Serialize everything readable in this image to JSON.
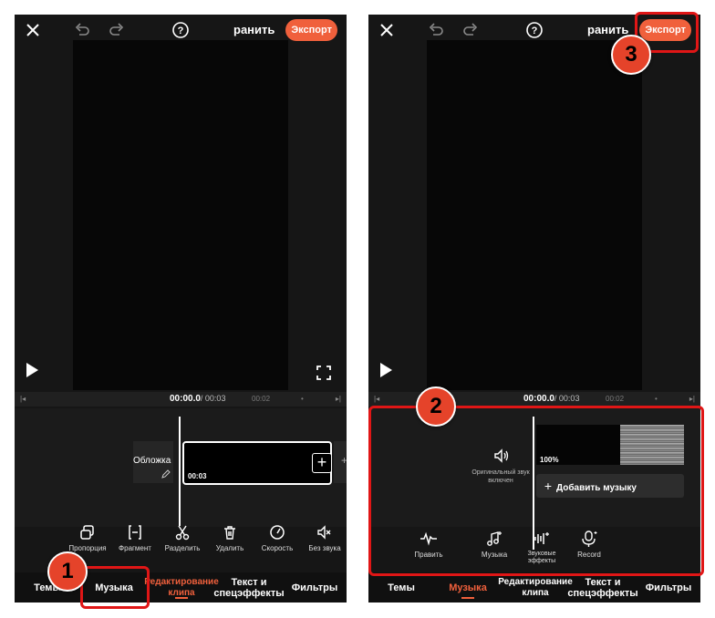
{
  "left": {
    "header": {
      "title": "ранить",
      "export_label": "Экспорт"
    },
    "timebar": {
      "current": "00:00.0",
      "total": "/ 00:03",
      "mark": "00:02"
    },
    "timeline": {
      "cover_label": "Обложка",
      "clip_duration": "00:03"
    },
    "tools": [
      {
        "label": "Пропорция",
        "icon": "aspect-ratio-icon"
      },
      {
        "label": "Фрагмент",
        "icon": "trim-icon"
      },
      {
        "label": "Разделить",
        "icon": "scissors-icon"
      },
      {
        "label": "Удалить",
        "icon": "trash-icon"
      },
      {
        "label": "Скорость",
        "icon": "speedometer-icon"
      },
      {
        "label": "Без звука",
        "icon": "mute-icon"
      }
    ],
    "tabs": [
      {
        "label": "Темы"
      },
      {
        "label": "Музыка"
      },
      {
        "label": "Редактирование клипа",
        "active": true
      },
      {
        "label": "Текст и спецэффекты"
      },
      {
        "label": "Фильтры"
      }
    ],
    "badge": "1"
  },
  "right": {
    "header": {
      "title": "ранить",
      "export_label": "Экспорт"
    },
    "timebar": {
      "current": "00:00.0",
      "total": "/ 00:03",
      "mark": "00:02"
    },
    "audio": {
      "original_sound_label": "Оригинальный звук включен",
      "volume": "100%",
      "add_music_label": "Добавить музыку"
    },
    "tools": [
      {
        "label": "Править",
        "icon": "waveform-icon"
      },
      {
        "label": "Музыка",
        "icon": "music-add-icon"
      },
      {
        "label": "Звуковые эффекты",
        "icon": "sound-effects-icon"
      },
      {
        "label": "Record",
        "icon": "microphone-icon"
      }
    ],
    "tabs": [
      {
        "label": "Темы"
      },
      {
        "label": "Музыка",
        "active": true
      },
      {
        "label": "Редактирование клипа"
      },
      {
        "label": "Текст и спецэффекты"
      },
      {
        "label": "Фильтры"
      }
    ],
    "badges": [
      "2",
      "3"
    ]
  },
  "colors": {
    "accent": "#f0603c",
    "highlight": "#e01616",
    "background": "#161616"
  }
}
